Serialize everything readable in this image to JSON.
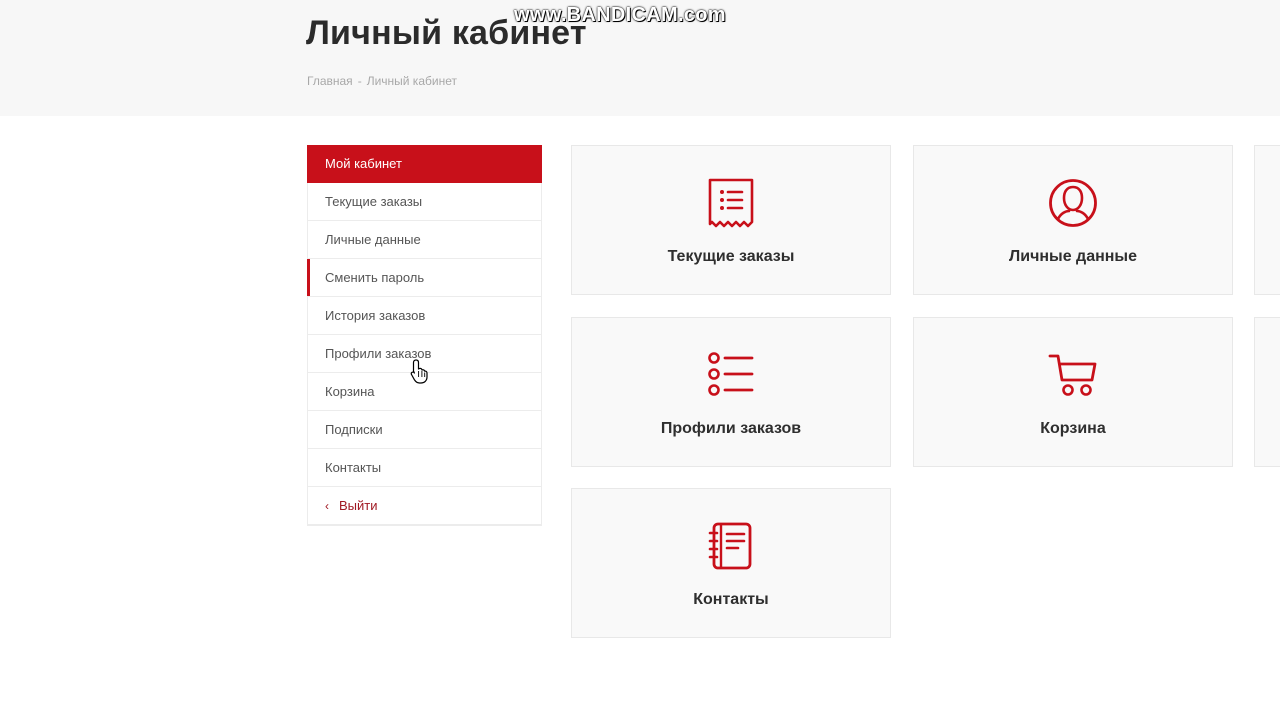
{
  "watermark": "www.BANDICAM.com",
  "page": {
    "title": "Личный кабинет",
    "breadcrumb": [
      "Главная",
      "-",
      "Личный кабинет"
    ]
  },
  "sidebar": {
    "items": [
      {
        "label": "Мой кабинет"
      },
      {
        "label": "Текущие заказы"
      },
      {
        "label": "Личные данные"
      },
      {
        "label": "Сменить пароль"
      },
      {
        "label": "История заказов"
      },
      {
        "label": "Профили заказов"
      },
      {
        "label": "Корзина"
      },
      {
        "label": "Подписки"
      },
      {
        "label": "Контакты"
      },
      {
        "label": "Выйти",
        "icon": "chevron-left-icon"
      }
    ]
  },
  "cards": [
    {
      "label": "Текущие заказы",
      "icon": "receipt-list-icon"
    },
    {
      "label": "Личные данные",
      "icon": "user-circle-icon"
    },
    {
      "label": "Профили заказов",
      "icon": "bullet-list-icon"
    },
    {
      "label": "Корзина",
      "icon": "shopping-cart-icon"
    },
    {
      "label": "Контакты",
      "icon": "notebook-icon"
    }
  ],
  "colors": {
    "accent": "#c8101a",
    "header_bg": "#f7f7f7",
    "card_bg": "#f9f9f9"
  }
}
